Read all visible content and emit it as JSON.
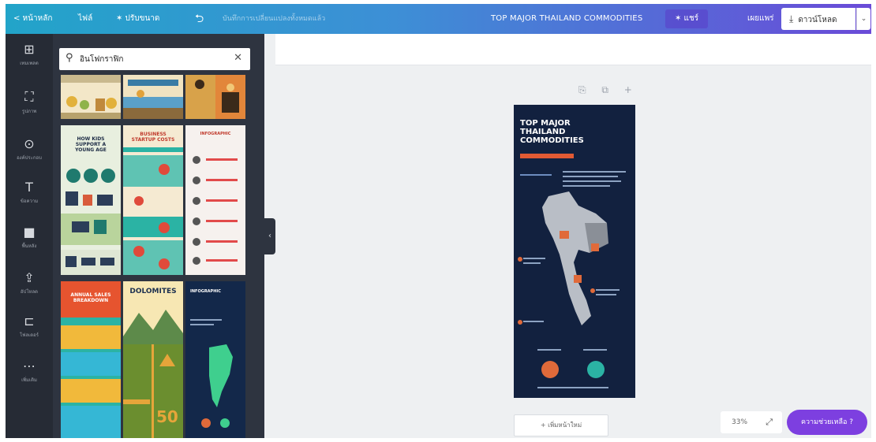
{
  "topbar": {
    "back_label": "< หน้าหลัก",
    "file_label": "ไฟล์",
    "resize_label": "✶ ปรับขนาด",
    "undo_label": "⮌",
    "saved_label": "บันทึกการเปลี่ยนแปลงทั้งหมดแล้ว",
    "doc_title": "TOP MAJOR THAILAND COMMODITIES",
    "share_label": "✶ แชร์",
    "publish_label": "เผยแพร่",
    "download_label": "ดาวน์โหลด",
    "download_icon": "⤓",
    "dropdown_icon": "⌄"
  },
  "rail": {
    "items": [
      {
        "icon": "⊞",
        "label": "เทมเพลต"
      },
      {
        "icon": "⛶",
        "label": "รูปภาพ"
      },
      {
        "icon": "⊙",
        "label": "องค์ประกอบ"
      },
      {
        "icon": "T",
        "label": "ข้อความ"
      },
      {
        "icon": "■",
        "label": "พื้นหลัง"
      },
      {
        "icon": "⇪",
        "label": "อัปโหลด"
      },
      {
        "icon": "⊏",
        "label": "โฟลเดอร์"
      },
      {
        "icon": "⋯",
        "label": "เพิ่มเติม"
      }
    ]
  },
  "search": {
    "icon": "⚲",
    "value": "อินโฟกราฟิก",
    "clear_icon": "✕"
  },
  "templates": {
    "t1": "HOW KIDS SUPPORT A YOUNG AGE",
    "t2": "BUSINESS STARTUP COSTS",
    "t3": "INFOGRAPHIC",
    "t4": "ANNUAL SALES BREAKDOWN",
    "t5": "DOLOMITES",
    "t5_num": "50",
    "t6": "INFOGRAPHIC",
    "collapse_icon": "‹"
  },
  "canvas": {
    "page_tools": "⎘ ⧉ +",
    "design_title": "TOP MAJOR THAILAND COMMODITIES",
    "add_page_label": "+ เพิ่มหน้าใหม่",
    "zoom_label": "33%",
    "expand_icon": "⤢",
    "help_label": "ความช่วยเหลือ ?"
  },
  "colors": {
    "topbar_start": "#22a4c9",
    "topbar_end": "#6a4bd8",
    "rail_bg": "#262b35",
    "panel_bg": "#2e3440",
    "design_bg": "#12213f",
    "accent_orange": "#e15a34",
    "accent_teal": "#2bb3a4",
    "help_bg": "#7d3fe0"
  }
}
